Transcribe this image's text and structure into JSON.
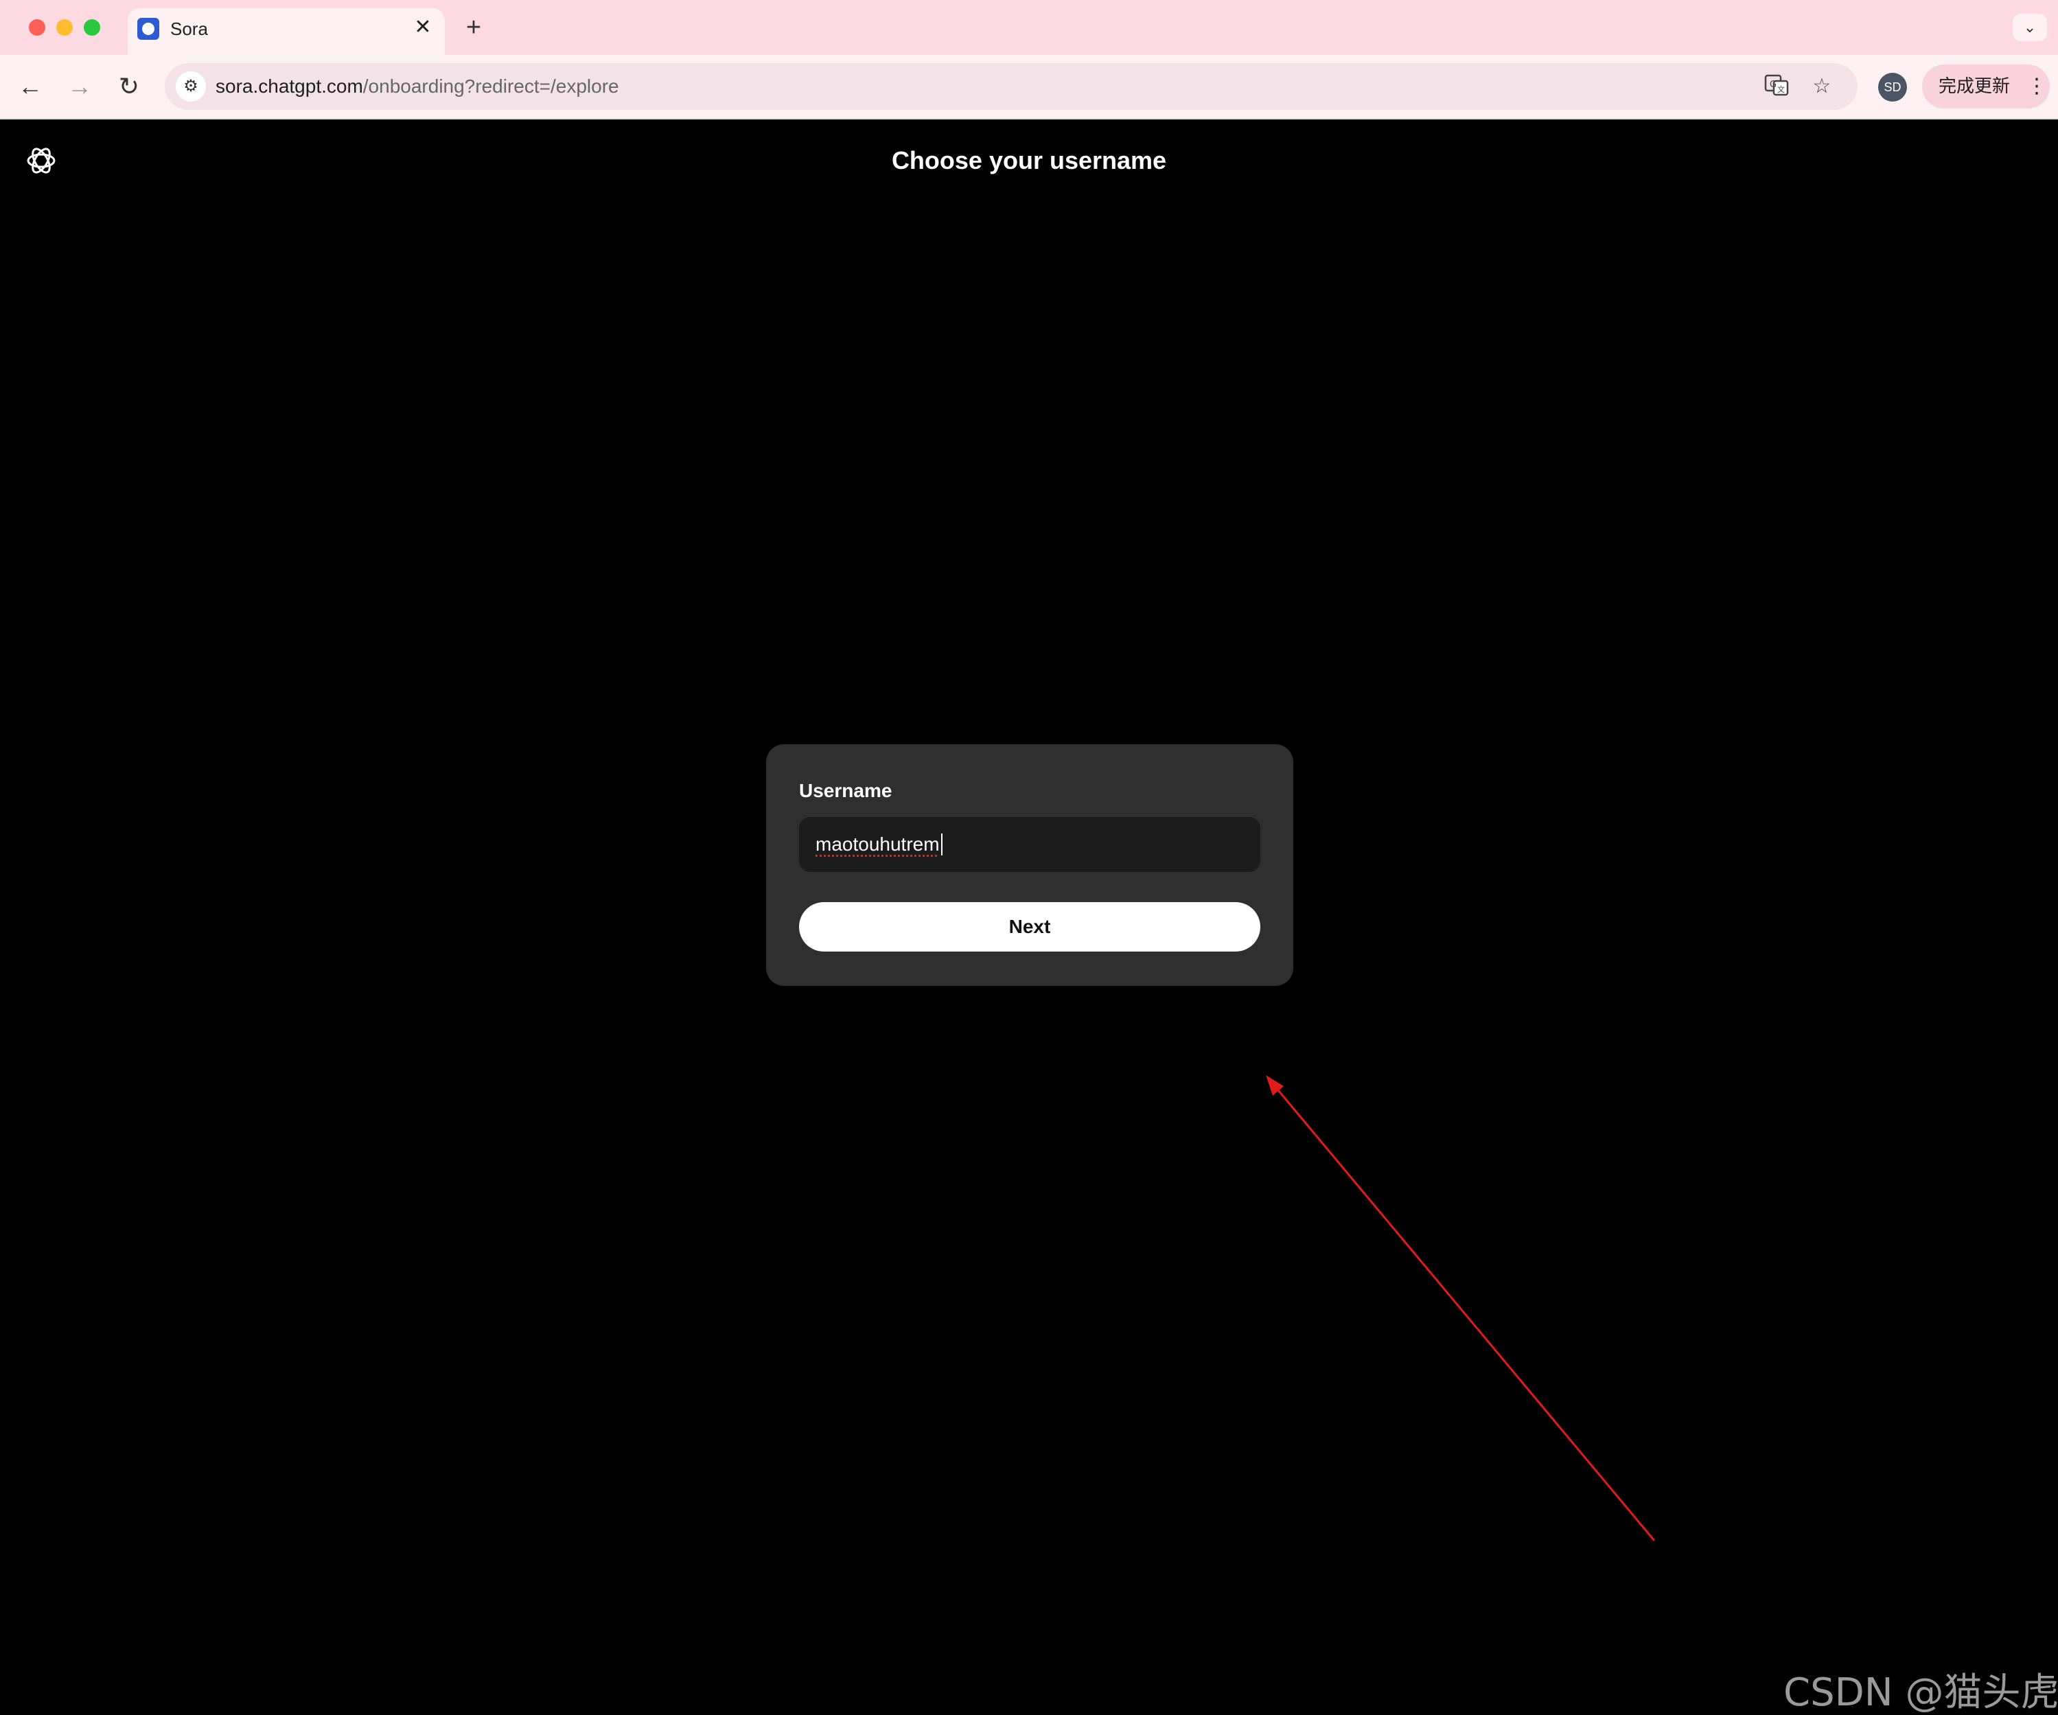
{
  "browser": {
    "tab": {
      "title": "Sora"
    },
    "url": {
      "host": "sora.chatgpt.com",
      "path": "/onboarding?redirect=/explore"
    },
    "profile_initials": "SD",
    "update_button_label": "完成更新"
  },
  "page": {
    "title": "Choose your username",
    "form": {
      "label": "Username",
      "value": "maotouhutrem",
      "submit_label": "Next"
    }
  },
  "watermark": "CSDN @猫头虎"
}
